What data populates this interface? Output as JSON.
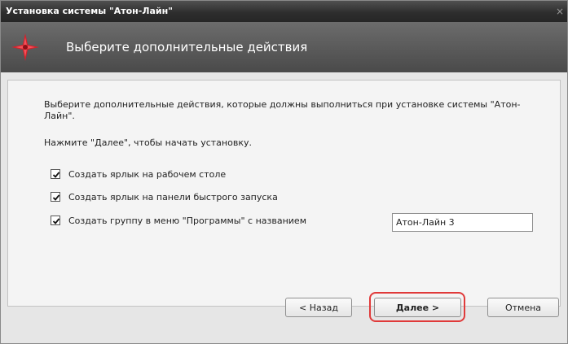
{
  "window": {
    "title": "Установка системы \"Атон-Лайн\"",
    "close_glyph": "×"
  },
  "header": {
    "heading": "Выберите дополнительные действия",
    "logo_icon": "aton-line-logo-icon"
  },
  "content": {
    "description": "Выберите дополнительные действия, которые должны выполниться при установке системы \"Атон-Лайн\".",
    "hint": "Нажмите \"Далее\", чтобы начать установку.",
    "options": [
      {
        "label": "Создать ярлык на рабочем столе",
        "checked": true
      },
      {
        "label": "Создать ярлык на панели быстрого запуска",
        "checked": true
      },
      {
        "label": "Создать группу в меню \"Программы\" с названием",
        "checked": true
      }
    ],
    "group_name_value": "Атон-Лайн 3"
  },
  "buttons": {
    "back": "< Назад",
    "next": "Далее >",
    "cancel": "Отмена"
  },
  "colors": {
    "titlebar": "#2e2e2e",
    "header": "#5a5a5a",
    "logo": "#d8202a",
    "highlight": "#e03a3a"
  }
}
